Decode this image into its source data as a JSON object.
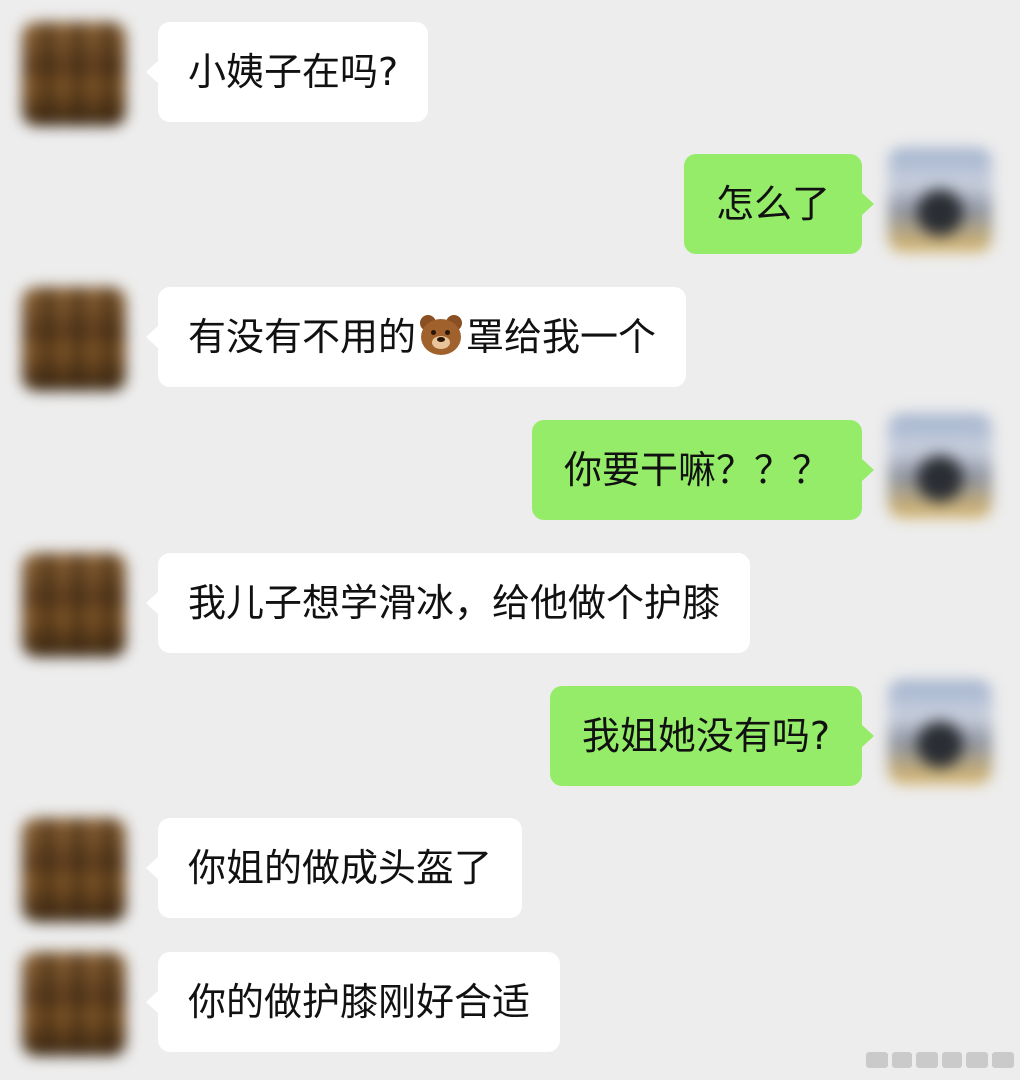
{
  "chat": {
    "messages": [
      {
        "sender": "other",
        "text": "小姨子在吗?"
      },
      {
        "sender": "me",
        "text": "怎么了"
      },
      {
        "sender": "other",
        "text_before": "有没有不用的",
        "emoji": "bear-face",
        "text_after": "罩给我一个"
      },
      {
        "sender": "me",
        "text": "你要干嘛？？？"
      },
      {
        "sender": "other",
        "text": "我儿子想学滑冰，给他做个护膝"
      },
      {
        "sender": "me",
        "text": "我姐她没有吗?"
      },
      {
        "sender": "other",
        "text": "你姐的做成头盔了"
      },
      {
        "sender": "other",
        "text": "你的做护膝刚好合适"
      }
    ]
  },
  "colors": {
    "background": "#ededed",
    "other_bubble": "#ffffff",
    "my_bubble": "#95ec69"
  }
}
